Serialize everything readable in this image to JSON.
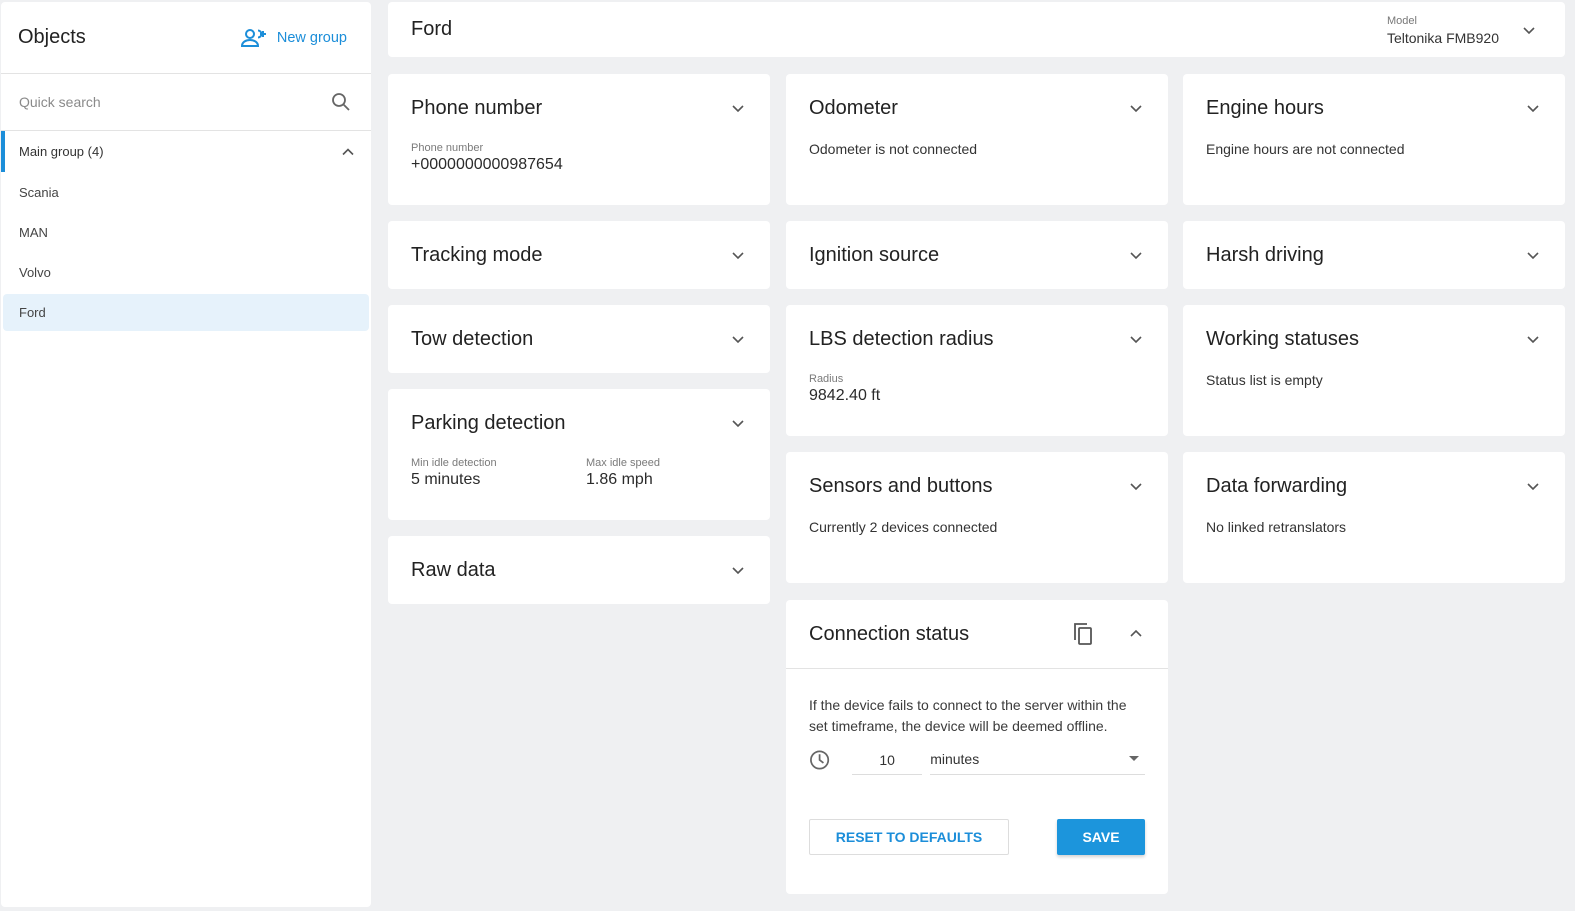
{
  "sidebar": {
    "title": "Objects",
    "new_group_label": "New group",
    "search_placeholder": "Quick search",
    "group": {
      "label": "Main group (4)",
      "expanded": true
    },
    "objects": [
      {
        "label": "Scania",
        "selected": false
      },
      {
        "label": "MAN",
        "selected": false
      },
      {
        "label": "Volvo",
        "selected": false
      },
      {
        "label": "Ford",
        "selected": true
      }
    ]
  },
  "header": {
    "title": "Ford",
    "model_label": "Model",
    "model_value": "Teltonika FMB920"
  },
  "cards": {
    "phone_number": {
      "title": "Phone number",
      "field_label": "Phone number",
      "field_value": "+0000000000987654"
    },
    "tracking_mode": {
      "title": "Tracking mode"
    },
    "tow_detection": {
      "title": "Tow detection"
    },
    "parking_detection": {
      "title": "Parking detection",
      "min_idle_label": "Min idle detection",
      "min_idle_value": "5 minutes",
      "max_idle_label": "Max idle speed",
      "max_idle_value": "1.86 mph"
    },
    "raw_data": {
      "title": "Raw data"
    },
    "odometer": {
      "title": "Odometer",
      "message": "Odometer is not connected"
    },
    "ignition_source": {
      "title": "Ignition source"
    },
    "lbs_detection_radius": {
      "title": "LBS detection radius",
      "field_label": "Radius",
      "field_value": "9842.40 ft"
    },
    "sensors_and_buttons": {
      "title": "Sensors and buttons",
      "message": "Currently 2 devices connected"
    },
    "connection_status": {
      "title": "Connection status",
      "description": "If the device fails to connect to the server within the set timeframe, the device will be deemed offline.",
      "timeout_value": "10",
      "timeout_unit": "minutes",
      "reset_label": "RESET TO DEFAULTS",
      "save_label": "SAVE"
    },
    "engine_hours": {
      "title": "Engine hours",
      "message": "Engine hours are not connected"
    },
    "harsh_driving": {
      "title": "Harsh driving"
    },
    "working_statuses": {
      "title": "Working statuses",
      "message": "Status list is empty"
    },
    "data_forwarding": {
      "title": "Data forwarding",
      "message": "No linked retranslators"
    }
  },
  "colors": {
    "accent": "#1c8ed9",
    "save_button": "#1c95dc",
    "selected_row": "#e6f2fb",
    "background": "#eff0f2"
  }
}
